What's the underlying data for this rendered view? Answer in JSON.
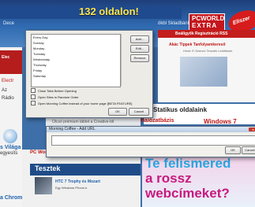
{
  "magazine": {
    "headline": "132 oldalon!",
    "sub_left": "Dece",
    "sub_right": "ökbl Skladbánl",
    "logo_line1": "PCWORLD",
    "logo_line2": "EXTRA",
    "badge": "Eliszer",
    "nav_links": "Beállgyők  Regisztráció  RSS",
    "nav_links2": "Akác Tippek Tanfolyamkereső",
    "nav_links3": "Hírek  IT-Szerviz  Tesztek  Letöltések",
    "left_labels": [
      "Electr",
      "Az",
      "Rádio"
    ],
    "left_red_text": "Elec",
    "left_blue1": "Vilá",
    "left_blue_lines": [
      "s Világa",
      "egyesíts"
    ],
    "left_red_bottom": "PC World tanácsokkal",
    "left_dark": "a Chrome",
    "mid_heading": "Statikus oldalaink",
    "mid_red": "Hálózatbázis",
    "mid_windows": "Windows 7",
    "center_strip": "Olcsó prémium táblet a Creative-tól",
    "red_line": "PC World tanácsokkal",
    "news_title": "Tesztek",
    "news_line1": "HTC 7 Trophy és Mozart",
    "news_line2": "Egy Windows Phone-k",
    "ad_lines": [
      "Te felismered",
      "a rossz",
      "webcímeket?"
    ],
    "ad_colors": [
      "#2aa6df",
      "#c8197e",
      "#c8197e"
    ]
  },
  "dialog_days": {
    "list_items": [
      "Every Day",
      "Sunday",
      "Monday",
      "Tuesday",
      "Wednesday",
      "Thursday",
      "Friday",
      "Saturday"
    ],
    "buttons": {
      "add": "Add...",
      "edit": "Edit...",
      "remove": "Remove"
    },
    "checkboxes": [
      "Close Tabs Before Opening",
      "Open Sites in Random Order",
      "Open Morning Coffee instead of your home page [BETA FEATURE]"
    ],
    "ok": "OK",
    "cancel": "Cancel"
  },
  "dialog_url": {
    "title": "Morning Coffee - Add URL",
    "close": "×",
    "url_value": "",
    "ok": "OK",
    "cancel": "Cancel"
  }
}
